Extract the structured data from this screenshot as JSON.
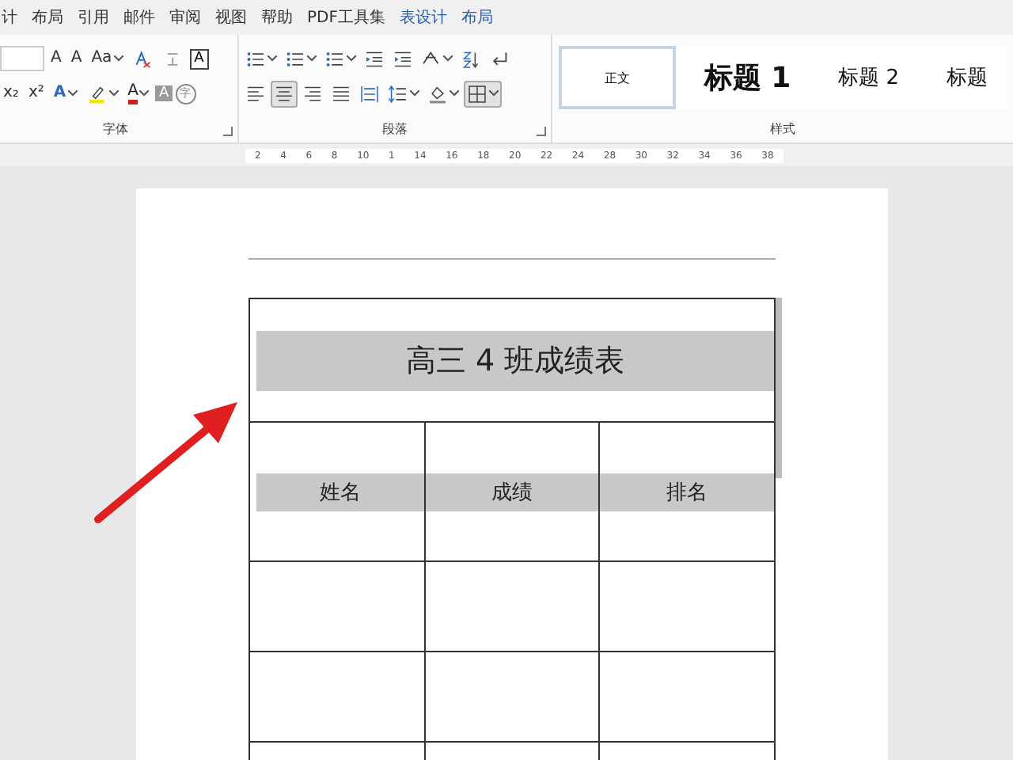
{
  "tabs": [
    {
      "label": "计",
      "kind": "normal",
      "selected": false
    },
    {
      "label": "布局",
      "kind": "normal",
      "selected": false
    },
    {
      "label": "引用",
      "kind": "normal",
      "selected": false
    },
    {
      "label": "邮件",
      "kind": "normal",
      "selected": false
    },
    {
      "label": "审阅",
      "kind": "normal",
      "selected": false
    },
    {
      "label": "视图",
      "kind": "normal",
      "selected": false
    },
    {
      "label": "帮助",
      "kind": "normal",
      "selected": false
    },
    {
      "label": "PDF工具集",
      "kind": "normal",
      "selected": false
    },
    {
      "label": "表设计",
      "kind": "contextual",
      "selected": false
    },
    {
      "label": "布局",
      "kind": "contextual",
      "selected": false
    }
  ],
  "font_group": {
    "label": "字体",
    "row1": [
      {
        "kind": "size-field"
      },
      {
        "kind": "glyph",
        "glyph": "A",
        "caret": false
      },
      {
        "kind": "glyph",
        "glyph": "A",
        "caret": false
      },
      {
        "kind": "glyph",
        "glyph": "Aa",
        "caret": true
      },
      {
        "kind": "clear"
      },
      {
        "kind": "phonetic"
      },
      {
        "kind": "boxed",
        "glyph": "A"
      }
    ],
    "row2": [
      {
        "kind": "glyph",
        "glyph": "x₂",
        "caret": false
      },
      {
        "kind": "glyph",
        "glyph": "x²",
        "caret": false
      },
      {
        "kind": "effect",
        "glyph": "A",
        "caret": true
      },
      {
        "kind": "highlight",
        "caret": true
      },
      {
        "kind": "color",
        "glyph": "A",
        "caret": true
      },
      {
        "kind": "shaded",
        "glyph": "A"
      },
      {
        "kind": "circled",
        "glyph": "字"
      }
    ]
  },
  "paragraph_group": {
    "label": "段落",
    "row1": [
      {
        "kind": "bullets",
        "caret": true
      },
      {
        "kind": "numbering",
        "caret": true
      },
      {
        "kind": "multilevel",
        "caret": true
      },
      {
        "kind": "outdent",
        "caret": false
      },
      {
        "kind": "indent",
        "caret": false
      },
      {
        "kind": "asian",
        "caret": true
      },
      {
        "kind": "sort",
        "caret": false
      },
      {
        "kind": "marks",
        "caret": false
      }
    ],
    "row2": [
      {
        "kind": "align-left",
        "caret": false,
        "selected": false
      },
      {
        "kind": "align-center",
        "caret": false,
        "selected": true
      },
      {
        "kind": "align-right",
        "caret": false,
        "selected": false
      },
      {
        "kind": "justify",
        "caret": false,
        "selected": false
      },
      {
        "kind": "distribute",
        "caret": false,
        "selected": false
      },
      {
        "kind": "spacing",
        "caret": true,
        "selected": false
      },
      {
        "kind": "fill",
        "caret": true,
        "selected": false
      },
      {
        "kind": "borders",
        "caret": true,
        "selected": true
      }
    ]
  },
  "styles_group": {
    "label": "样式",
    "styles": [
      {
        "label": "正文",
        "kind": "body",
        "selected": true
      },
      {
        "label": "标题 1",
        "kind": "h1",
        "selected": false
      },
      {
        "label": "标题 2",
        "kind": "h2",
        "selected": false
      },
      {
        "label": "标题",
        "kind": "h3",
        "selected": false
      }
    ]
  },
  "ruler": [
    "2",
    "4",
    "6",
    "8",
    "10",
    "1",
    "14",
    "16",
    "18",
    "20",
    "22",
    "24",
    "28",
    "30",
    "32",
    "34",
    "36",
    "38"
  ],
  "table": {
    "title": "高三 4 班成绩表",
    "columns": [
      "姓名",
      "成绩",
      "排名"
    ]
  }
}
